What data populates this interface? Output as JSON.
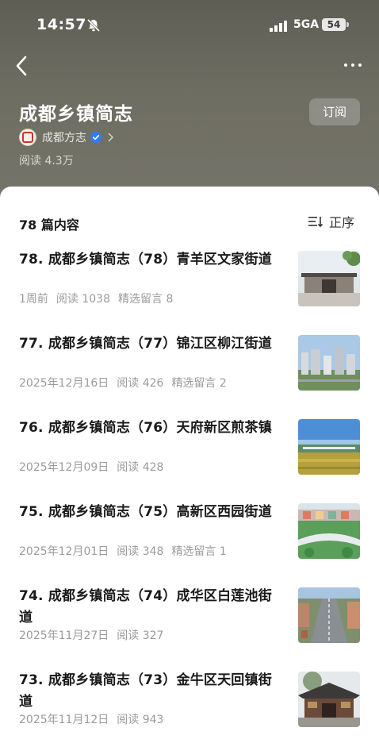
{
  "status_bar": {
    "time": "14:57",
    "network": "5GA",
    "battery": "54"
  },
  "header": {
    "title": "成都乡镇简志",
    "subscribe_label": "订阅",
    "author": "成都方志",
    "read_count": "阅读 4.3万"
  },
  "list_header": {
    "count_label": "78 篇内容",
    "sort_label": "正序"
  },
  "articles": [
    {
      "title": "78. 成都乡镇简志（78）青羊区文家街道",
      "date": "1周前",
      "reads": "阅读 1038",
      "comments": "精选留言 8",
      "thumb": "traditional-gate"
    },
    {
      "title": "77. 成都乡镇简志（77）锦江区柳江街道",
      "date": "2025年12月16日",
      "reads": "阅读 426",
      "comments": "精选留言 2",
      "thumb": "city-buildings"
    },
    {
      "title": "76. 成都乡镇简志（76）天府新区煎茶镇",
      "date": "2025年12月09日",
      "reads": "阅读 428",
      "comments": "",
      "thumb": "bridge-fields"
    },
    {
      "title": "75. 成都乡镇简志（75）高新区西园街道",
      "date": "2025年12月01日",
      "reads": "阅读 348",
      "comments": "精选留言 1",
      "thumb": "green-campus"
    },
    {
      "title": "74. 成都乡镇简志（74）成华区白莲池街道",
      "date": "2025年11月27日",
      "reads": "阅读 327",
      "comments": "",
      "thumb": "street-aerial"
    },
    {
      "title": "73. 成都乡镇简志（73）金牛区天回镇街道",
      "date": "2025年11月12日",
      "reads": "阅读 943",
      "comments": "",
      "thumb": "temple-roof"
    }
  ],
  "colors": {
    "header_bg": "#6b6a5f",
    "verified": "#2f7cf6",
    "meta_text": "#9b9b9b"
  }
}
